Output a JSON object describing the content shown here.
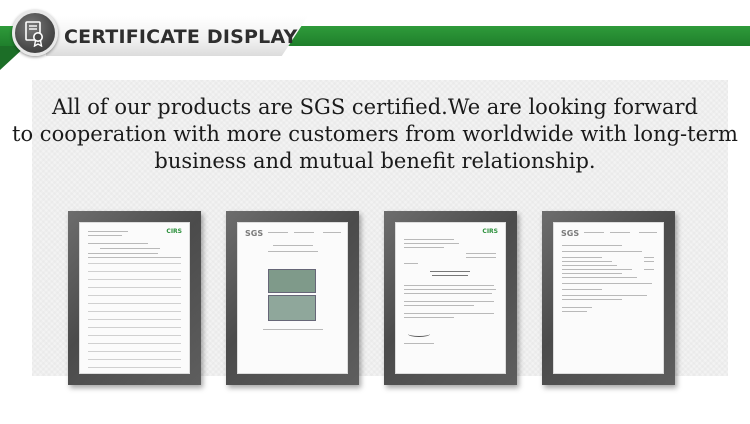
{
  "header": {
    "title": "CERTIFICATE DISPLAY",
    "badge_icon": "certificate-icon",
    "accent_color": "#2a8a35"
  },
  "intro": {
    "lines": [
      "All of our products are SGS certified.We are looking forward",
      "to cooperation with more customers from worldwide with long-term",
      "business and mutual benefit relationship."
    ]
  },
  "certificates": [
    {
      "name": "cirs-pre-registration-list",
      "logo": "CIRS"
    },
    {
      "name": "sgs-test-report-photo-appendix",
      "logo": "SGS"
    },
    {
      "name": "cirs-confirmation-letter",
      "logo": "CIRS"
    },
    {
      "name": "sgs-test-report",
      "logo": "SGS"
    }
  ]
}
